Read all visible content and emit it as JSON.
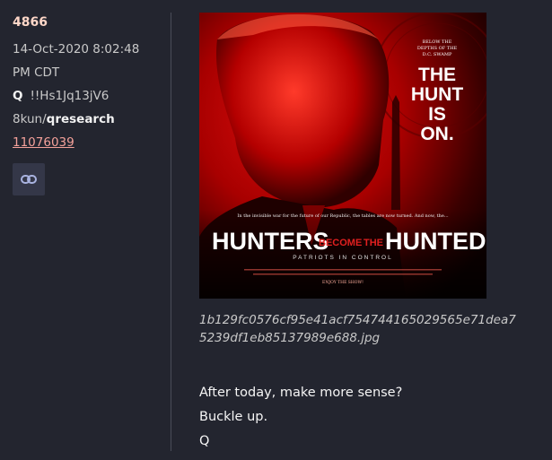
{
  "post": {
    "number": "4866",
    "date_line1": "14-Oct-2020 8:02:48",
    "date_line2": "PM CDT",
    "author_name": "Q",
    "tripcode": "!!Hs1Jq13jV6",
    "board_prefix": "8kun/",
    "board_name": "qresearch",
    "reference": "11076039"
  },
  "link_button": {
    "icon": "link-icon"
  },
  "image": {
    "filename": "1b129fc0576cf95e41acf754744165029565e71dea75239df1eb85137989e688.jpg",
    "small_text_1": "BELOW THE",
    "small_text_2": "DEPTHS OF THE",
    "small_text_3": "D.C. SWAMP",
    "hunt_1": "THE",
    "hunt_2": "HUNT",
    "hunt_3": "IS",
    "hunt_4": "ON.",
    "tagline": "In the invisible war for the future of our Republic, the tables are now turned. And now, the...",
    "title_part1": "HUNTERS",
    "title_part2": "BECOME",
    "title_part3": "THE",
    "title_part4": "HUNTED",
    "subtitle": "PATRIOTS IN CONTROL",
    "footer": "ENJOY THE SHOW!"
  },
  "message": {
    "line1": "After today, make more sense?",
    "line2": "Buckle up.",
    "line3": "Q"
  },
  "colors": {
    "background": "#23252f",
    "post_number": "#ffd7c8",
    "link": "#f4a19a",
    "divider": "#4a4d59",
    "button_bg": "#343748",
    "poster_red": "#c40000"
  }
}
